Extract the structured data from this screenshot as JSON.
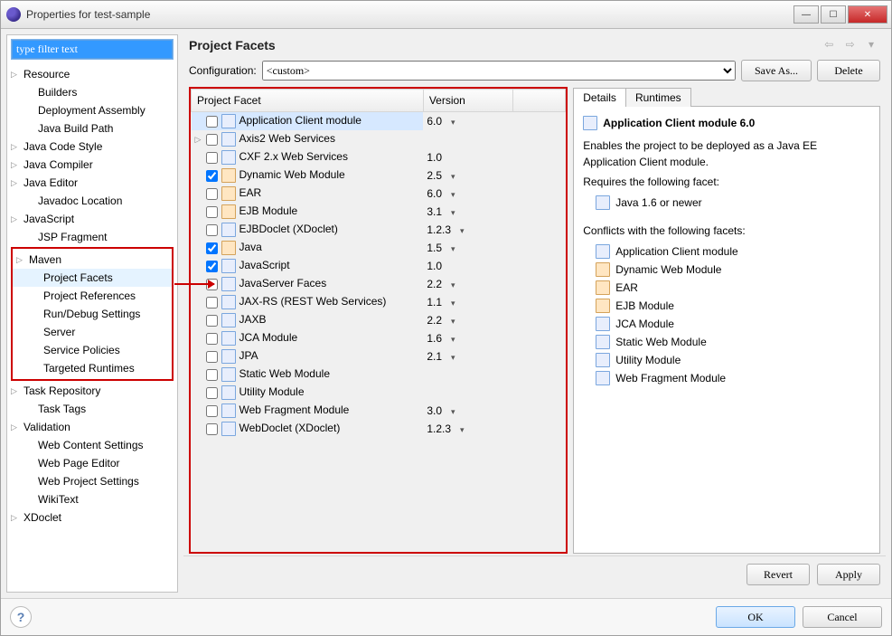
{
  "window": {
    "title": "Properties for test-sample"
  },
  "filter": {
    "placeholder": "type filter text"
  },
  "tree": [
    {
      "label": "Resource",
      "expandable": true,
      "level": 0
    },
    {
      "label": "Builders",
      "level": 1
    },
    {
      "label": "Deployment Assembly",
      "level": 1
    },
    {
      "label": "Java Build Path",
      "level": 1
    },
    {
      "label": "Java Code Style",
      "expandable": true,
      "level": 0
    },
    {
      "label": "Java Compiler",
      "expandable": true,
      "level": 0
    },
    {
      "label": "Java Editor",
      "expandable": true,
      "level": 0
    },
    {
      "label": "Javadoc Location",
      "level": 1
    },
    {
      "label": "JavaScript",
      "expandable": true,
      "level": 0
    },
    {
      "label": "JSP Fragment",
      "level": 1
    }
  ],
  "tree_highlight": [
    {
      "label": "Maven",
      "expandable": true,
      "level": 0
    },
    {
      "label": "Project Facets",
      "level": 1,
      "selected": true
    },
    {
      "label": "Project References",
      "level": 1
    },
    {
      "label": "Run/Debug Settings",
      "level": 1
    },
    {
      "label": "Server",
      "level": 1
    },
    {
      "label": "Service Policies",
      "level": 1
    },
    {
      "label": "Targeted Runtimes",
      "level": 1
    }
  ],
  "tree_after": [
    {
      "label": "Task Repository",
      "expandable": true,
      "level": 0
    },
    {
      "label": "Task Tags",
      "level": 1
    },
    {
      "label": "Validation",
      "expandable": true,
      "level": 0
    },
    {
      "label": "Web Content Settings",
      "level": 1
    },
    {
      "label": "Web Page Editor",
      "level": 1
    },
    {
      "label": "Web Project Settings",
      "level": 1
    },
    {
      "label": "WikiText",
      "level": 1
    },
    {
      "label": "XDoclet",
      "expandable": true,
      "level": 0
    }
  ],
  "page": {
    "title": "Project Facets",
    "config_label": "Configuration:",
    "config_value": "<custom>",
    "save_as": "Save As...",
    "delete": "Delete",
    "revert": "Revert",
    "apply": "Apply"
  },
  "columns": {
    "facet": "Project Facet",
    "version": "Version"
  },
  "facets": [
    {
      "name": "Application Client module",
      "version": "6.0",
      "checked": false,
      "selected": true,
      "drop": true
    },
    {
      "name": "Axis2 Web Services",
      "version": "",
      "checked": false,
      "expandable": true
    },
    {
      "name": "CXF 2.x Web Services",
      "version": "1.0",
      "checked": false
    },
    {
      "name": "Dynamic Web Module",
      "version": "2.5",
      "checked": true,
      "alt": true,
      "drop": true
    },
    {
      "name": "EAR",
      "version": "6.0",
      "checked": false,
      "alt": true,
      "drop": true
    },
    {
      "name": "EJB Module",
      "version": "3.1",
      "checked": false,
      "alt": true,
      "drop": true
    },
    {
      "name": "EJBDoclet (XDoclet)",
      "version": "1.2.3",
      "checked": false,
      "drop": true
    },
    {
      "name": "Java",
      "version": "1.5",
      "checked": true,
      "alt": true,
      "drop": true
    },
    {
      "name": "JavaScript",
      "version": "1.0",
      "checked": true
    },
    {
      "name": "JavaServer Faces",
      "version": "2.2",
      "checked": false,
      "drop": true
    },
    {
      "name": "JAX-RS (REST Web Services)",
      "version": "1.1",
      "checked": false,
      "drop": true
    },
    {
      "name": "JAXB",
      "version": "2.2",
      "checked": false,
      "drop": true
    },
    {
      "name": "JCA Module",
      "version": "1.6",
      "checked": false,
      "drop": true
    },
    {
      "name": "JPA",
      "version": "2.1",
      "checked": false,
      "drop": true
    },
    {
      "name": "Static Web Module",
      "version": "",
      "checked": false
    },
    {
      "name": "Utility Module",
      "version": "",
      "checked": false
    },
    {
      "name": "Web Fragment Module",
      "version": "3.0",
      "checked": false,
      "drop": true
    },
    {
      "name": "WebDoclet (XDoclet)",
      "version": "1.2.3",
      "checked": false,
      "drop": true
    }
  ],
  "tabs": {
    "details": "Details",
    "runtimes": "Runtimes"
  },
  "details": {
    "title": "Application Client module 6.0",
    "desc": "Enables the project to be deployed as a Java EE Application Client module.",
    "requires_label": "Requires the following facet:",
    "requires": [
      {
        "name": "Java 1.6 or newer"
      }
    ],
    "conflicts_label": "Conflicts with the following facets:",
    "conflicts": [
      {
        "name": "Application Client module"
      },
      {
        "name": "Dynamic Web Module",
        "alt": true
      },
      {
        "name": "EAR",
        "alt": true
      },
      {
        "name": "EJB Module",
        "alt": true
      },
      {
        "name": "JCA Module"
      },
      {
        "name": "Static Web Module"
      },
      {
        "name": "Utility Module"
      },
      {
        "name": "Web Fragment Module"
      }
    ]
  },
  "footer": {
    "ok": "OK",
    "cancel": "Cancel"
  }
}
